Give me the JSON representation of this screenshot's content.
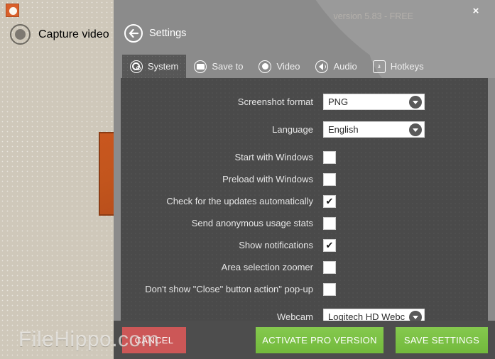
{
  "background_app": {
    "app_icon": "icecream-app-icon",
    "capture_video_label": "Capture video",
    "capture_caret_icon": "caret-down-icon",
    "record_icon": "record-circle-icon"
  },
  "watermark": {
    "text": "FileHippo.com"
  },
  "header": {
    "version_text": "version 5.83 - FREE",
    "close_icon": "×",
    "back_icon": "←",
    "title": "Settings"
  },
  "tabs": [
    {
      "label": "System",
      "icon": "gear-icon",
      "active": true
    },
    {
      "label": "Save to",
      "icon": "folder-icon",
      "active": false
    },
    {
      "label": "Video",
      "icon": "record-icon",
      "active": false
    },
    {
      "label": "Audio",
      "icon": "speaker-icon",
      "active": false
    },
    {
      "label": "Hotkeys",
      "icon": "keyboard-key-icon",
      "active": false
    }
  ],
  "settings": {
    "screenshot_format": {
      "label": "Screenshot format",
      "value": "PNG",
      "type": "dropdown"
    },
    "language": {
      "label": "Language",
      "value": "English",
      "type": "dropdown"
    },
    "start_with_windows": {
      "label": "Start with Windows",
      "checked": "",
      "type": "checkbox"
    },
    "preload_with_windows": {
      "label": "Preload with Windows",
      "checked": "",
      "type": "checkbox"
    },
    "check_updates": {
      "label": "Check for the updates automatically",
      "checked": "✔",
      "type": "checkbox"
    },
    "anonymous_stats": {
      "label": "Send anonymous usage stats",
      "checked": "",
      "type": "checkbox"
    },
    "show_notifications": {
      "label": "Show notifications",
      "checked": "✔",
      "type": "checkbox"
    },
    "area_selection_zoomer": {
      "label": "Area selection zoomer",
      "checked": "",
      "type": "checkbox"
    },
    "no_close_popup": {
      "label": "Don't show \"Close\" button action\" pop-up",
      "checked": "",
      "type": "checkbox"
    },
    "webcam": {
      "label": "Webcam",
      "value": "Logitech HD Webc",
      "type": "dropdown"
    }
  },
  "footer": {
    "cancel_label": "CANCEL",
    "activate_label": "ACTIVATE PRO VERSION",
    "save_label": "SAVE SETTINGS"
  },
  "colors": {
    "window_header": "#8b8b8b",
    "panel": "#4a4a4a",
    "footer": "#4d4d4d",
    "accent_green": "#79c143",
    "cancel_red": "#cc5757",
    "app_orange": "#d95f2a",
    "desktop_beige": "#cfc8ba"
  }
}
